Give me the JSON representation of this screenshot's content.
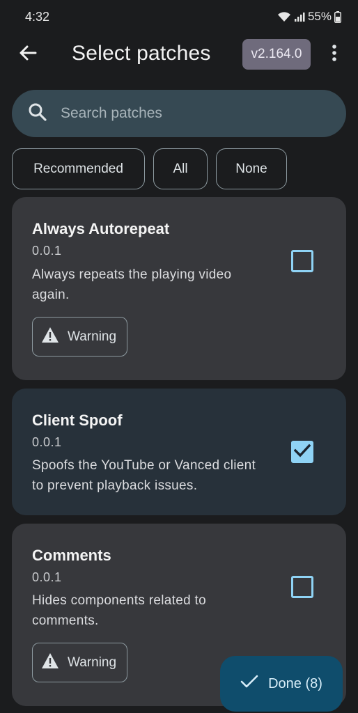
{
  "status": {
    "time": "4:32",
    "battery": "55%"
  },
  "header": {
    "title": "Select patches",
    "version": "v2.164.0"
  },
  "search": {
    "placeholder": "Search patches",
    "value": ""
  },
  "filters": [
    {
      "label": "Recommended"
    },
    {
      "label": "All"
    },
    {
      "label": "None"
    }
  ],
  "patches": [
    {
      "name": "Always Autorepeat",
      "version": "0.0.1",
      "description": "Always repeats the playing video again.",
      "selected": false,
      "warning": "Warning"
    },
    {
      "name": "Client Spoof",
      "version": "0.0.1",
      "description": "Spoofs the YouTube or Vanced client to prevent playback issues.",
      "selected": true
    },
    {
      "name": "Comments",
      "version": "0.0.1",
      "description": "Hides components related to comments.",
      "selected": false,
      "warning": "Warning"
    }
  ],
  "fab": {
    "label": "Done (8)"
  },
  "colors": {
    "accent": "#8fd3f5",
    "fab": "#0f4d6c",
    "card": "#37383c",
    "card_selected": "#27313a",
    "version_chip": "#6f6b7c"
  }
}
